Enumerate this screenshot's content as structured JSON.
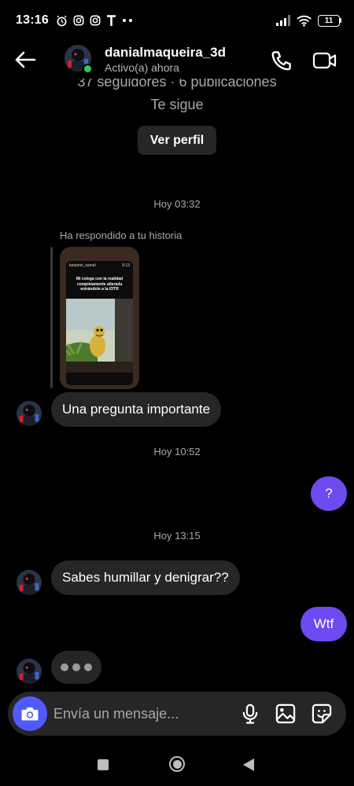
{
  "status_bar": {
    "time": "13:16",
    "battery": "11",
    "icons": [
      "alarm-icon",
      "instagram-icon",
      "instagram-icon",
      "t-icon",
      "more-dots-icon",
      "signal-icon",
      "wifi-icon",
      "battery-icon"
    ]
  },
  "header": {
    "username": "danialmaqueira_3d",
    "status": "Activo(a) ahora",
    "online_color": "#2fcc4e"
  },
  "profile": {
    "stats": "37 seguidores · 6 publicaciones",
    "follows_you": "Te sigue",
    "view_profile_label": "Ver perfil"
  },
  "messages": {
    "ts1": "Hoy 03:32",
    "reply_label": "Ha respondido a tu historia",
    "story": {
      "username": "ketamin_samel",
      "time": "0:13",
      "caption": "Mi colega con la realidad completamente alterada entrándole a la IOTR"
    },
    "msg1": "Una pregunta importante",
    "ts2": "Hoy 10:52",
    "msg2": "?",
    "ts3": "Hoy 13:15",
    "msg3": "Sabes humillar y denigrar??",
    "msg4": "Wtf",
    "typing": true
  },
  "composer": {
    "placeholder": "Envía un mensaje..."
  },
  "colors": {
    "accent": "#6e4bf0",
    "camera": "#4f5bff",
    "bubble_in": "#262626"
  }
}
